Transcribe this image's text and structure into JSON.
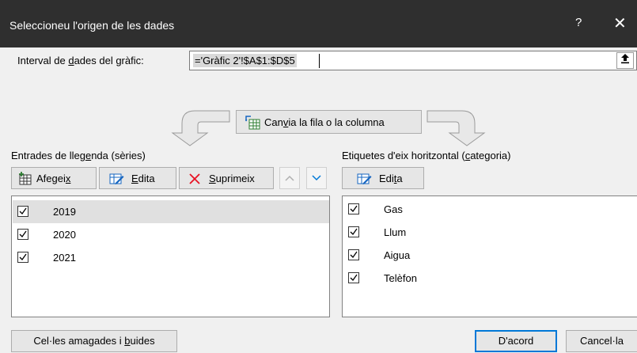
{
  "dialog": {
    "title": "Seleccioneu l'origen de les dades",
    "help": "?",
    "close": "✕"
  },
  "range": {
    "label_pre": "Interval de ",
    "label_key": "d",
    "label_post": "ades del gràfic:",
    "value": "='Gràfic 2'!$A$1:$D$5"
  },
  "switch_button": {
    "pre": "Can",
    "key": "v",
    "post": "ia la fila o la columna"
  },
  "series_panel": {
    "label_pre": "Entrades de lleg",
    "label_key": "e",
    "label_post": "nda (sèries)",
    "add_pre": "Afegei",
    "add_key": "x",
    "edit_key": "E",
    "edit_post": "dita",
    "remove_key": "S",
    "remove_post": "uprimeix",
    "items": [
      "2019",
      "2020",
      "2021"
    ]
  },
  "category_panel": {
    "label_pre": "Etiquetes d'eix horitzontal (",
    "label_key": "c",
    "label_post": "ategoria)",
    "edit_pre": "Edi",
    "edit_key": "t",
    "edit_post": "a",
    "items": [
      "Gas",
      "Llum",
      "Aigua",
      "Telèfon"
    ]
  },
  "footer": {
    "hidden_pre": "Cel·les amagades i ",
    "hidden_key": "b",
    "hidden_post": "uides",
    "ok": "D'acord",
    "cancel": "Cancel·la"
  },
  "colors": {
    "titlebar": "#2f2f2f",
    "accent": "#0078d7",
    "remove_red": "#e81123"
  }
}
